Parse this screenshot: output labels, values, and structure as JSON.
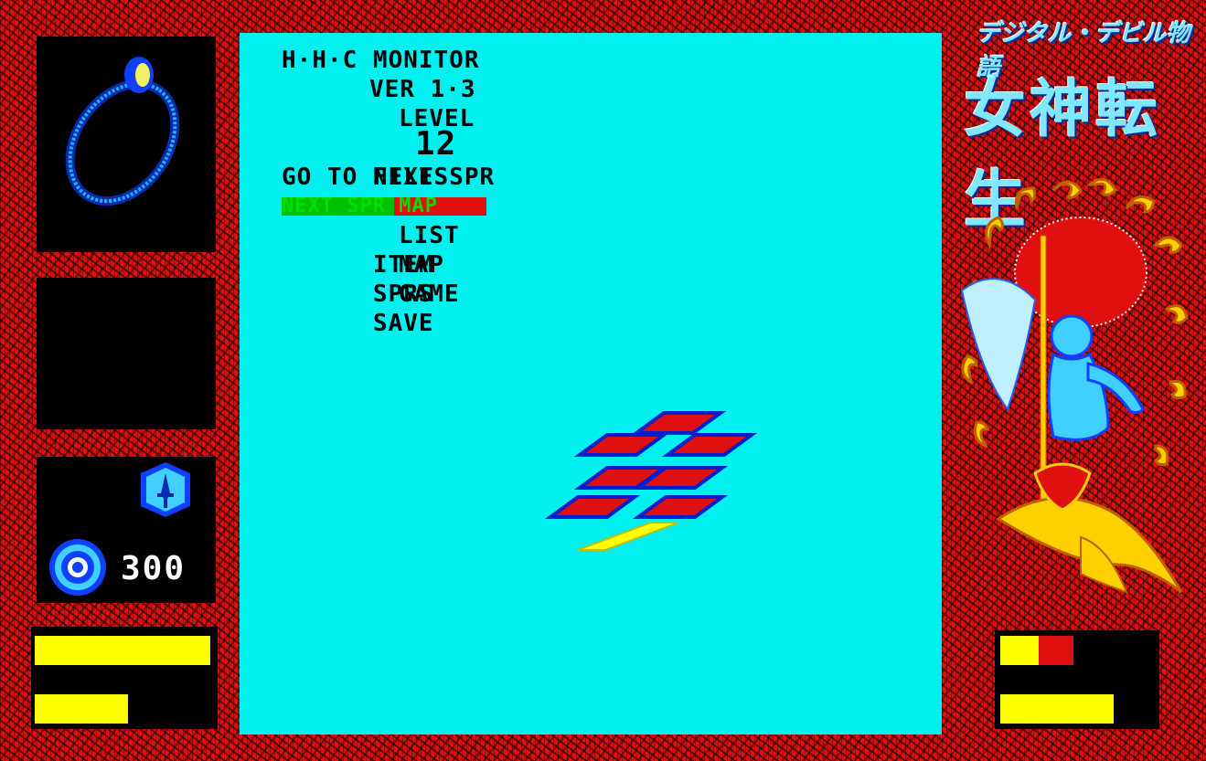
{
  "game": {
    "monitor_title": "H·H·C MONITOR",
    "version": "VER 1·3",
    "level_label": "LEVEL",
    "files_label": "FILES",
    "level_value": "12",
    "goto_text": "GO TO NEXT SPR",
    "selected_option": "NEXT SPR MAP",
    "menu": [
      {
        "left": "ITEM",
        "right": "LIST"
      },
      {
        "left": "SPRS",
        "right": "MAP"
      },
      {
        "left": "SAVE",
        "right": "GAME"
      }
    ],
    "money": "300",
    "title_logo_small": "デジタル・デビル物語",
    "title_logo_large": "女神転生"
  },
  "status": {
    "left_bar_1_fill": 1.0,
    "left_bar_2_fill": 0.53,
    "right_bar_1_yellow_fill": 0.23,
    "right_bar_1_red_fill": 0.21,
    "right_bar_2_fill": 0.73
  },
  "colors": {
    "background": "#000000",
    "frame": "#e01010",
    "viewport": "#00f0f0",
    "bar": "#ffff00",
    "accent_blue": "#1040ff"
  }
}
